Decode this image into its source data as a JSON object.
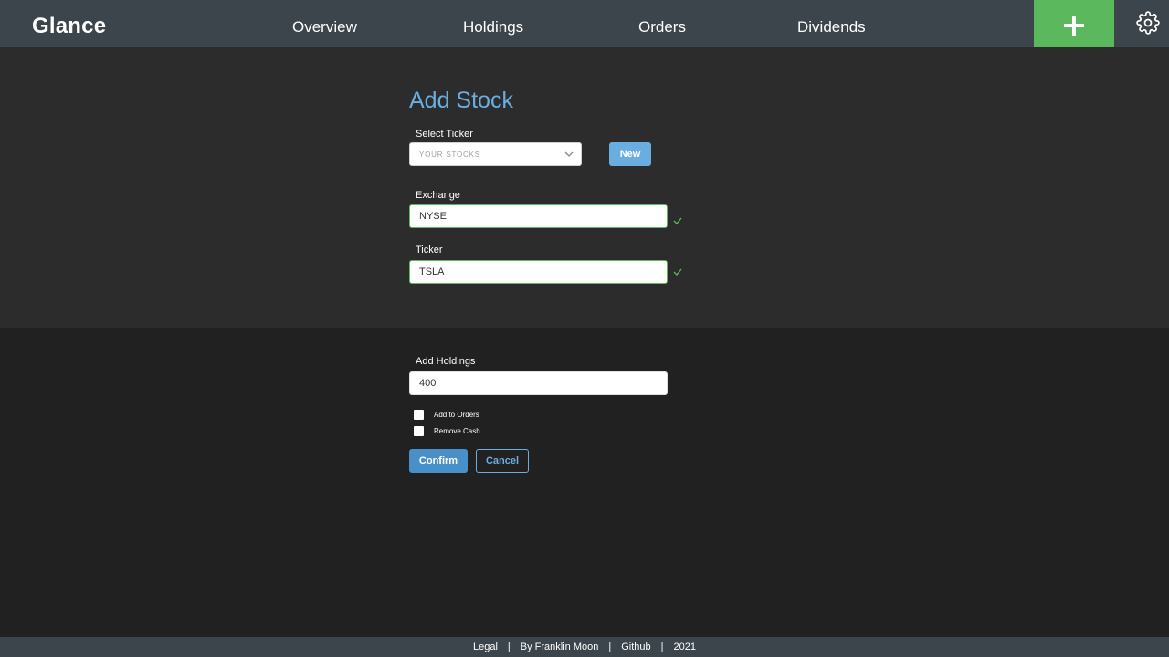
{
  "header": {
    "logo": "Glance",
    "nav": [
      "Overview",
      "Holdings",
      "Orders",
      "Dividends"
    ],
    "add_icon": "plus-icon",
    "settings_icon": "gear-icon",
    "add_button_color": "#5cb85c"
  },
  "form": {
    "title": "Add Stock",
    "select_ticker": {
      "label": "Select Ticker",
      "placeholder": "YOUR STOCKS",
      "new_label": "New"
    },
    "exchange": {
      "label": "Exchange",
      "value": "NYSE",
      "valid": true
    },
    "ticker": {
      "label": "Ticker",
      "value": "TSLA",
      "valid": true
    },
    "holdings": {
      "label": "Add Holdings",
      "value": "400"
    },
    "checkboxes": [
      {
        "label": "Add to Orders",
        "checked": false
      },
      {
        "label": "Remove Cash",
        "checked": false
      }
    ],
    "confirm_label": "Confirm",
    "cancel_label": "Cancel"
  },
  "footer": {
    "links": [
      "Legal",
      "By Franklin Moon",
      "Github",
      "2021"
    ]
  },
  "colors": {
    "accent": "#6aaee0",
    "valid": "#5cb85c",
    "header_bg": "#3b454b"
  }
}
